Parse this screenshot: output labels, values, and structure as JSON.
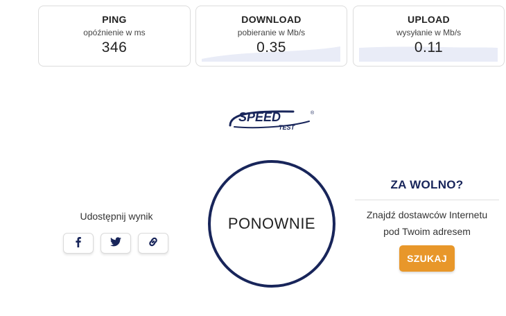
{
  "stats": {
    "ping": {
      "title": "PING",
      "subtitle": "opóźnienie w ms",
      "value": "346"
    },
    "download": {
      "title": "DOWNLOAD",
      "subtitle": "pobieranie w Mb/s",
      "value": "0.35"
    },
    "upload": {
      "title": "UPLOAD",
      "subtitle": "wysyłanie w Mb/s",
      "value": "0.11"
    }
  },
  "logo": {
    "main": "SPEED",
    "sub": "TEST",
    "mark": "®"
  },
  "share": {
    "label": "Udostępnij wynik",
    "facebook_icon": "facebook-icon",
    "twitter_icon": "twitter-icon",
    "link_icon": "link-icon"
  },
  "retest": {
    "label": "PONOWNIE"
  },
  "too_slow": {
    "title": "ZA WOLNO?",
    "line1": "Znajdź dostawców Internetu",
    "line2": "pod Twoim adresem",
    "button": "SZUKAJ"
  },
  "colors": {
    "navy": "#18255a",
    "accent": "#e8972a",
    "sparkline": "#e9ecf7"
  }
}
